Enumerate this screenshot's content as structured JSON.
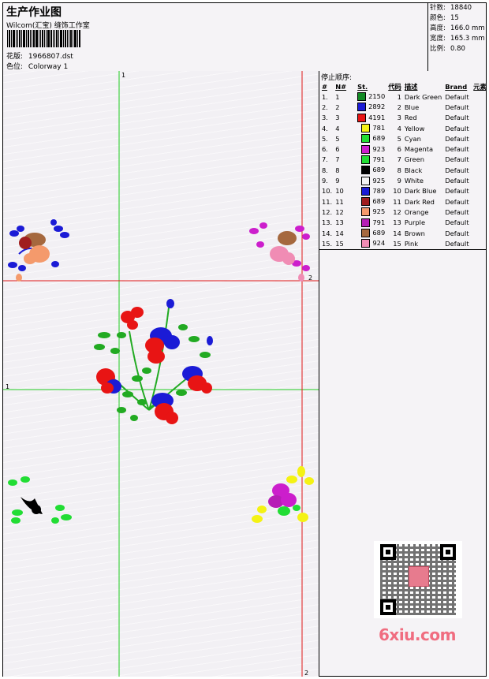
{
  "header": {
    "title": "生产作业图",
    "company": "Wilcom(汇宝) 缝饰工作室",
    "design_label": "花版:",
    "design_value": "1966807.dst",
    "colorway_label": "色位:",
    "colorway_value": "Colorway 1"
  },
  "stats": [
    {
      "label": "针数:",
      "value": "18840"
    },
    {
      "label": "颜色:",
      "value": "15"
    },
    {
      "label": "高度:",
      "value": "166.0 mm"
    },
    {
      "label": "宽度:",
      "value": "165.3 mm"
    },
    {
      "label": "比例:",
      "value": "0.80"
    }
  ],
  "stop_sequence": {
    "title": "停止顺序:",
    "columns": [
      "#",
      "N#",
      "St.",
      "代码",
      "描述",
      "Brand",
      "元素"
    ],
    "rows": [
      {
        "n": "1.",
        "nn": "1",
        "color": "#128a24",
        "st": "2150",
        "code": "1",
        "desc": "Dark Green",
        "brand": "Default"
      },
      {
        "n": "2.",
        "nn": "2",
        "color": "#1b1bd6",
        "st": "2892",
        "code": "2",
        "desc": "Blue",
        "brand": "Default"
      },
      {
        "n": "3.",
        "nn": "3",
        "color": "#e81414",
        "st": "4191",
        "code": "3",
        "desc": "Red",
        "brand": "Default"
      },
      {
        "n": "4.",
        "nn": "4",
        "color": "#f4f214",
        "st": "781",
        "code": "4",
        "desc": "Yellow",
        "brand": "Default"
      },
      {
        "n": "5.",
        "nn": "5",
        "color": "#22dd34",
        "st": "689",
        "code": "5",
        "desc": "Cyan",
        "brand": "Default"
      },
      {
        "n": "6.",
        "nn": "6",
        "color": "#cc1ecc",
        "st": "923",
        "code": "6",
        "desc": "Magenta",
        "brand": "Default"
      },
      {
        "n": "7.",
        "nn": "7",
        "color": "#22dd34",
        "st": "791",
        "code": "7",
        "desc": "Green",
        "brand": "Default"
      },
      {
        "n": "8.",
        "nn": "8",
        "color": "#000000",
        "st": "689",
        "code": "8",
        "desc": "Black",
        "brand": "Default"
      },
      {
        "n": "9.",
        "nn": "9",
        "color": "#f4f4f4",
        "st": "925",
        "code": "9",
        "desc": "White",
        "brand": "Default"
      },
      {
        "n": "10.",
        "nn": "10",
        "color": "#1b1bd6",
        "st": "789",
        "code": "10",
        "desc": "Dark Blue",
        "brand": "Default"
      },
      {
        "n": "11.",
        "nn": "11",
        "color": "#a01e1e",
        "st": "689",
        "code": "11",
        "desc": "Dark Red",
        "brand": "Default"
      },
      {
        "n": "12.",
        "nn": "12",
        "color": "#f49a6c",
        "st": "925",
        "code": "12",
        "desc": "Orange",
        "brand": "Default"
      },
      {
        "n": "13.",
        "nn": "13",
        "color": "#b61eb6",
        "st": "791",
        "code": "13",
        "desc": "Purple",
        "brand": "Default"
      },
      {
        "n": "14.",
        "nn": "14",
        "color": "#a5683e",
        "st": "689",
        "code": "14",
        "desc": "Brown",
        "brand": "Default"
      },
      {
        "n": "15.",
        "nn": "15",
        "color": "#f08cb4",
        "st": "924",
        "code": "15",
        "desc": "Pink",
        "brand": "Default"
      }
    ]
  },
  "guides": {
    "green_label_top": "1",
    "green_label_left": "1",
    "red_label_mid": "2",
    "red_label_bottom": "2"
  },
  "watermark": "6xiu.com"
}
